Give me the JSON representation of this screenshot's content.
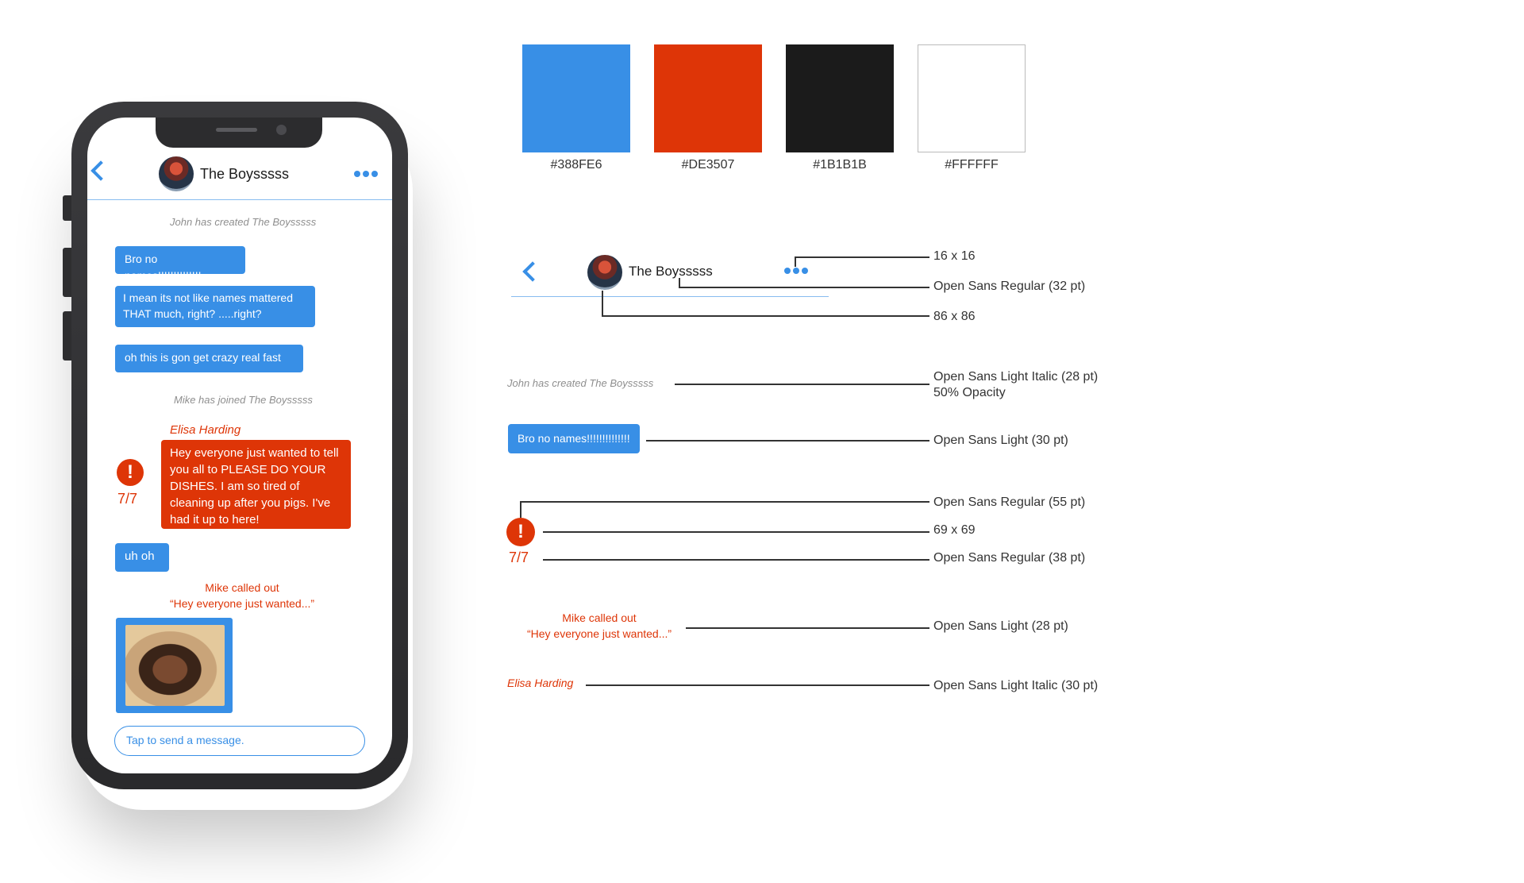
{
  "chat": {
    "title": "The Boysssss",
    "system_created": "John has created The Boysssss",
    "system_joined": "Mike has joined The Boysssss",
    "messages": [
      {
        "text": "Bro no names!!!!!!!!!!!!!!"
      },
      {
        "text": "I mean its not like names mattered THAT much, right? .....right?"
      },
      {
        "text": "oh this is gon get crazy real fast"
      },
      {
        "text": "uh oh"
      }
    ],
    "flagged": {
      "sender": "Elisa Harding",
      "text": "Hey everyone just wanted to tell you all to PLEASE DO YOUR DISHES. I am so tired of cleaning up after you pigs. I've had it up to here!",
      "alert_glyph": "!",
      "count": "7/7"
    },
    "callout_line1": "Mike called out",
    "callout_line2": "“Hey everyone just wanted...”",
    "input_placeholder": "Tap to send a message."
  },
  "palette": [
    {
      "hex": "#388FE6",
      "label": "#388FE6"
    },
    {
      "hex": "#DE3507",
      "label": "#DE3507"
    },
    {
      "hex": "#1B1B1B",
      "label": "#1B1B1B"
    },
    {
      "hex": "#FFFFFF",
      "label": "#FFFFFF"
    }
  ],
  "spec": {
    "title": "The Boysssss",
    "system_text": "John has created The Boysssss",
    "bubble_text": "Bro no names!!!!!!!!!!!!!!",
    "alert_glyph": "!",
    "count": "7/7",
    "callout_line1": "Mike called out",
    "callout_line2": "“Hey everyone just wanted...”",
    "sender": "Elisa Harding",
    "labels": {
      "dots_size": "16 x 16",
      "title_font": "Open Sans Regular (32 pt)",
      "avatar_size": "86 x 86",
      "system_font": "Open Sans Light Italic (28 pt)",
      "system_opacity": "50% Opacity",
      "bubble_font": "Open Sans Light (30 pt)",
      "alert_font": "Open Sans Regular (55 pt)",
      "alert_size": "69 x 69",
      "count_font": "Open Sans Regular (38 pt)",
      "callout_font": "Open Sans Light (28 pt)",
      "sender_font": "Open Sans Light Italic (30 pt)"
    }
  },
  "icons": {
    "back": "chevron-left-icon",
    "more": "more-dots-icon",
    "alert": "alert-icon"
  },
  "colors": {
    "blue": "#388FE6",
    "red": "#DE3507",
    "black": "#1B1B1B",
    "white": "#FFFFFF"
  }
}
